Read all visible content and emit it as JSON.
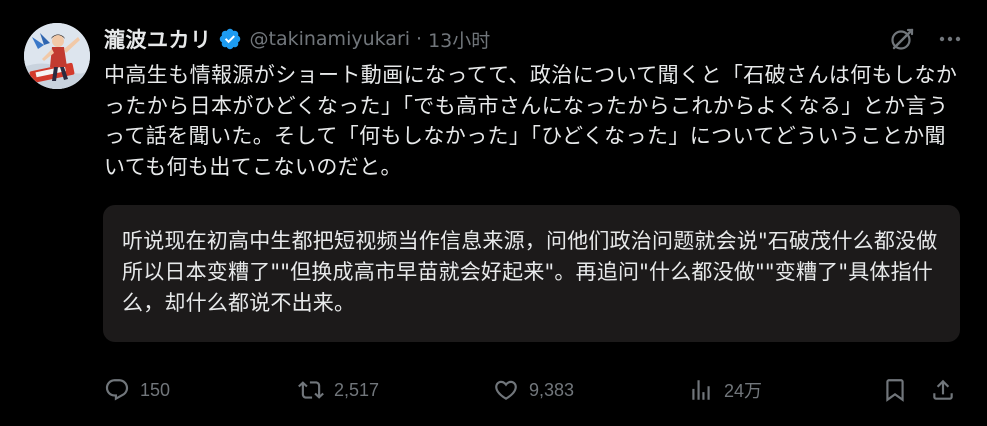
{
  "tweet": {
    "display_name": "瀧波ユカリ",
    "handle": "@takinamiyukari",
    "separator": "·",
    "time": "13小时",
    "body": "中高生も情報源がショート動画になってて、政治について聞くと「石破さんは何もしなかったから日本がひどくなった」「でも高市さんになったからこれからよくなる」とか言うって話を聞いた。そして「何もしなかった」「ひどくなった」についてどういうことか聞いても何も出てこないのだと。",
    "translation": "听说现在初高中生都把短视频当作信息来源，问他们政治问题就会说\"石破茂什么都没做所以日本变糟了\"\"但换成高市早苗就会好起来\"。再追问\"什么都没做\"\"变糟了\"具体指什么，却什么都说不出来。"
  },
  "icons": {
    "verified": "verified-badge-icon",
    "grok": "grok-icon",
    "more": "more-icon",
    "reply": "reply-icon",
    "retweet": "retweet-icon",
    "like": "like-icon",
    "views": "views-icon",
    "bookmark": "bookmark-icon",
    "share": "share-icon"
  },
  "stats": {
    "replies": "150",
    "retweets": "2,517",
    "likes": "9,383",
    "views": "24万"
  },
  "colors": {
    "background": "#000000",
    "text": "#e7e9ea",
    "muted": "#71767b",
    "verified": "#1d9bf0",
    "translation_bg": "#1c1a1a"
  }
}
